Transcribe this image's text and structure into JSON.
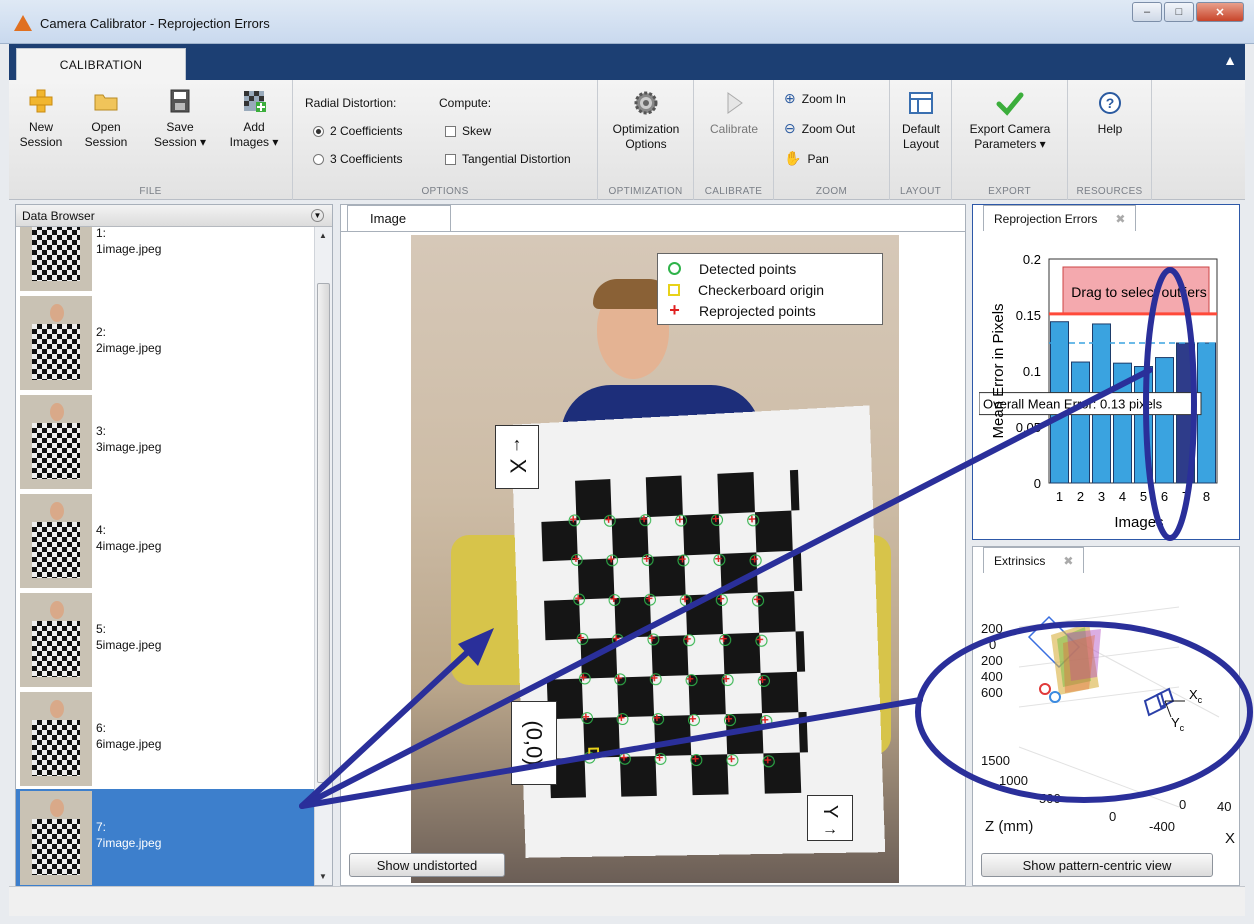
{
  "window": {
    "title": "Camera Calibrator - Reprojection Errors",
    "buttons": [
      "minimize",
      "maximize",
      "close"
    ]
  },
  "ribbon": {
    "tab": "CALIBRATION",
    "groups": {
      "file": {
        "label": "FILE",
        "new_session": [
          "New",
          "Session"
        ],
        "open_session": [
          "Open",
          "Session"
        ],
        "save_session": [
          "Save",
          "Session ▾"
        ],
        "add_images": [
          "Add",
          "Images ▾"
        ]
      },
      "options": {
        "label": "OPTIONS",
        "radial_label": "Radial Distortion:",
        "compute_label": "Compute:",
        "coeff2": "2 Coefficients",
        "coeff3": "3 Coefficients",
        "skew": "Skew",
        "tangential": "Tangential Distortion",
        "selected_coefficients": "2 Coefficients",
        "skew_checked": false,
        "tangential_checked": false
      },
      "optimization": {
        "label": "OPTIMIZATION",
        "button": [
          "Optimization",
          "Options"
        ]
      },
      "calibrate": {
        "label": "CALIBRATE",
        "button": "Calibrate"
      },
      "zoom": {
        "label": "ZOOM",
        "zoom_in": "Zoom In",
        "zoom_out": "Zoom Out",
        "pan": "Pan"
      },
      "layout": {
        "label": "LAYOUT",
        "button": [
          "Default",
          "Layout"
        ]
      },
      "export": {
        "label": "EXPORT",
        "button": [
          "Export Camera",
          "Parameters ▾"
        ]
      },
      "resources": {
        "label": "RESOURCES",
        "button": "Help"
      }
    }
  },
  "data_browser": {
    "title": "Data Browser",
    "items": [
      {
        "index": "1:",
        "name": "1image.jpeg"
      },
      {
        "index": "2:",
        "name": "2image.jpeg"
      },
      {
        "index": "3:",
        "name": "3image.jpeg"
      },
      {
        "index": "4:",
        "name": "4image.jpeg"
      },
      {
        "index": "5:",
        "name": "5image.jpeg"
      },
      {
        "index": "6:",
        "name": "6image.jpeg"
      },
      {
        "index": "7:",
        "name": "7image.jpeg"
      }
    ],
    "selected": "7:"
  },
  "image_panel": {
    "tab": "Image",
    "legend": [
      "Detected points",
      "Checkerboard origin",
      "Reprojected points"
    ],
    "axis_x": "X",
    "axis_y": "Y",
    "origin": "(0,0)",
    "button": "Show undistorted"
  },
  "reprojection_panel": {
    "tab": "Reprojection Errors",
    "ylabel": "Mean Error in Pixels",
    "xlabel": "Images",
    "yticks": [
      "0",
      "0.05",
      "0.1",
      "0.15",
      "0.2"
    ],
    "xticks": [
      "1",
      "2",
      "3",
      "4",
      "5",
      "6",
      "7",
      "8"
    ],
    "drag_text": "Drag to select outliers",
    "overall_text": "Overall Mean Error: 0.13 pixels"
  },
  "extrinsics_panel": {
    "tab": "Extrinsics",
    "yticks": [
      "200",
      "0",
      "200",
      "400",
      "600"
    ],
    "zticks": [
      "1500",
      "1000",
      "500",
      "0"
    ],
    "xticks": [
      "-400",
      "0",
      "40"
    ],
    "zlabel": "Z (mm)",
    "xlabel": "X",
    "cam_x": "X",
    "cam_x_sub": "c",
    "cam_y": "Y",
    "cam_y_sub": "c",
    "button": "Show pattern-centric view"
  },
  "chart_data": {
    "type": "bar",
    "categories": [
      "1",
      "2",
      "3",
      "4",
      "5",
      "6",
      "7",
      "8"
    ],
    "values": [
      0.144,
      0.108,
      0.142,
      0.107,
      0.104,
      0.112,
      0.125,
      0.125
    ],
    "highlighted": [
      "7"
    ],
    "overall_mean": 0.125,
    "threshold": 0.151,
    "title": "",
    "xlabel": "Images",
    "ylabel": "Mean Error in Pixels",
    "ylim": [
      0,
      0.2
    ],
    "colors": {
      "bar": "#3aa3e0",
      "selected_bar": "#2e3c8a",
      "mean_line": "#3aa3e0",
      "threshold": "#ff4a3a",
      "selection_box": "#f4a9ae"
    }
  },
  "colors": {
    "accent": "#1c3f73",
    "selection": "#3d7fcc",
    "annotation": "#2a2f9a",
    "detected": "#2fb34a",
    "origin": "#e8d21a",
    "reprojected": "#e02020"
  }
}
